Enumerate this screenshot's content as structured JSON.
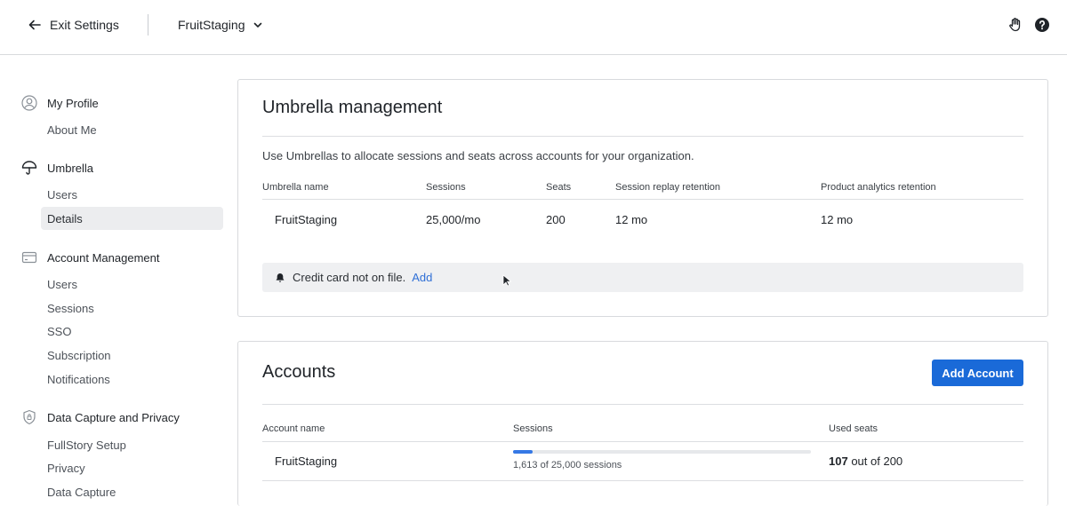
{
  "topbar": {
    "exit_label": "Exit Settings",
    "account_switcher": "FruitStaging",
    "icons": [
      "arrow-left-icon",
      "chevron-down-icon",
      "hand-icon",
      "help-icon"
    ]
  },
  "sidebar": {
    "sections": [
      {
        "title": "My Profile",
        "icon": "user-circle-icon",
        "items": [
          "About Me"
        ]
      },
      {
        "title": "Umbrella",
        "icon": "umbrella-icon",
        "items": [
          "Users",
          "Details"
        ]
      },
      {
        "title": "Account Management",
        "icon": "credit-card-icon",
        "items": [
          "Users",
          "Sessions",
          "SSO",
          "Subscription",
          "Notifications"
        ]
      },
      {
        "title": "Data Capture and Privacy",
        "icon": "shield-icon",
        "items": [
          "FullStory Setup",
          "Privacy",
          "Data Capture"
        ]
      }
    ],
    "active_item": "Details"
  },
  "umbrella": {
    "title": "Umbrella management",
    "description": "Use Umbrellas to allocate sessions and seats across accounts for your organization.",
    "columns": [
      "Umbrella name",
      "Sessions",
      "Seats",
      "Session replay retention",
      "Product analytics retention"
    ],
    "row": [
      "FruitStaging",
      "25,000/mo",
      "200",
      "12 mo",
      "12 mo"
    ],
    "banner_text": "Credit card not on file.",
    "banner_link": "Add"
  },
  "accounts": {
    "title": "Accounts",
    "add_button": "Add Account",
    "columns": [
      "Account name",
      "Sessions",
      "Used seats"
    ],
    "rows": [
      {
        "name": "FruitStaging",
        "sessions_used": 1613,
        "sessions_total": 25000,
        "sessions_label": "1,613 of 25,000 sessions",
        "seats_used": "107",
        "seats_suffix": "out of 200"
      }
    ]
  },
  "colors": {
    "accent": "#1a6ad8",
    "link": "#2f6fd6",
    "progress": "#3578e5",
    "active_bg": "#ecedef",
    "banner_bg": "#eff0f2"
  }
}
